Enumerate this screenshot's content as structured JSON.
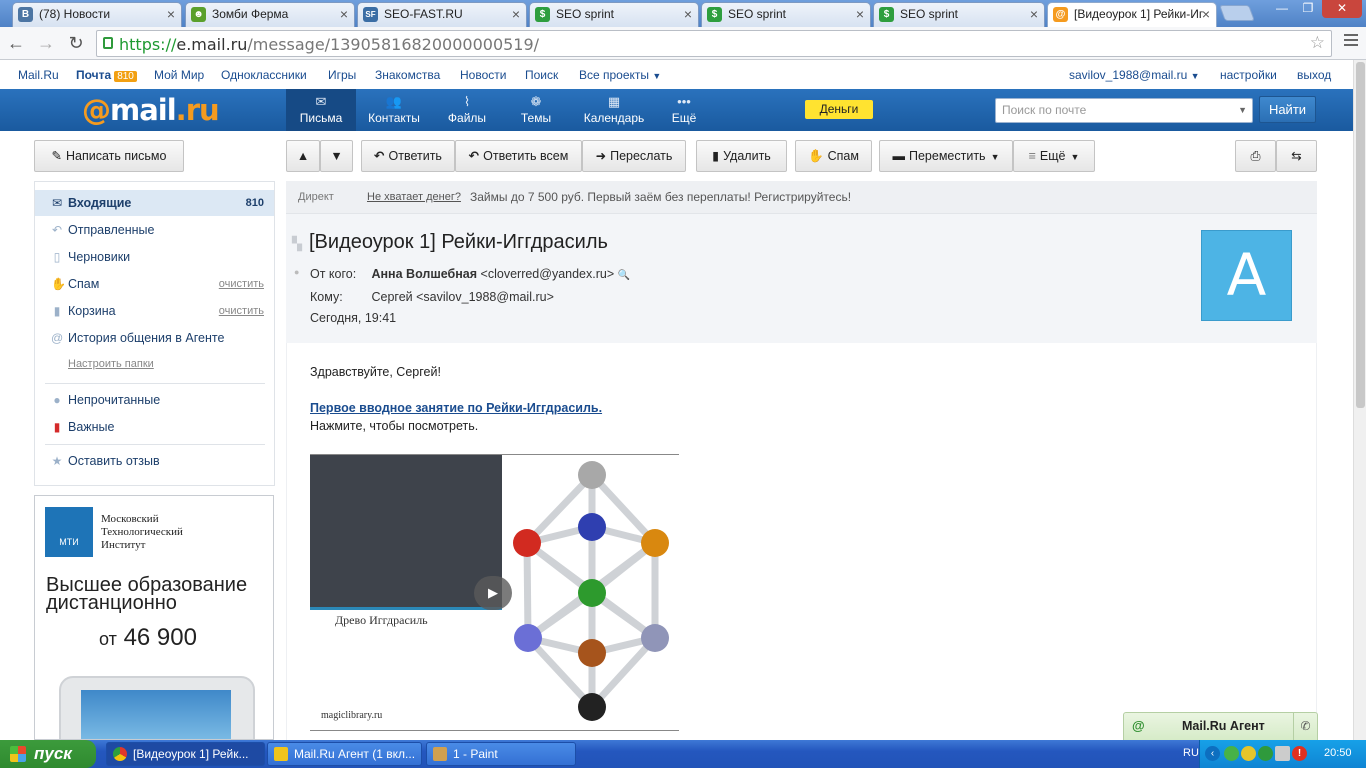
{
  "browser": {
    "tabs": [
      {
        "title": "(78) Новости",
        "icon": "vk-icon",
        "color": "#4c75a3",
        "glyph": "B"
      },
      {
        "title": "Зомби Ферма",
        "icon": "zombie-icon",
        "color": "#5aa02c",
        "glyph": "☻"
      },
      {
        "title": "SEO-FAST.RU",
        "icon": "seofast-icon",
        "color": "#3b6ea5",
        "glyph": "SF"
      },
      {
        "title": "SEO sprint",
        "icon": "seosprint-icon",
        "color": "#2e9e3e",
        "glyph": "$"
      },
      {
        "title": "SEO sprint",
        "icon": "seosprint-icon",
        "color": "#2e9e3e",
        "glyph": "$"
      },
      {
        "title": "SEO sprint",
        "icon": "seosprint-icon",
        "color": "#2e9e3e",
        "glyph": "$"
      },
      {
        "title": "[Видеоурок 1] Рейки-Иг",
        "icon": "mailru-icon",
        "color": "#f59b1f",
        "glyph": "@"
      }
    ],
    "url_scheme": "https://",
    "url_host": "e.mail.ru",
    "url_path": "/message/13905816820000000519/"
  },
  "portal": {
    "links": [
      "Mail.Ru",
      "Почта",
      "Мой Мир",
      "Одноклассники",
      "Игры",
      "Знакомства",
      "Новости",
      "Поиск",
      "Все проекты"
    ],
    "mail_count": "810",
    "user": "savilov_1988@mail.ru",
    "settings": "настройки",
    "logout": "выход"
  },
  "header": {
    "logo_at": "@",
    "logo_text": "mail",
    "logo_ru": ".ru",
    "nav": [
      {
        "label": "Письма",
        "icon": "envelope-icon"
      },
      {
        "label": "Контакты",
        "icon": "contacts-icon"
      },
      {
        "label": "Файлы",
        "icon": "paperclip-icon"
      },
      {
        "label": "Темы",
        "icon": "palette-icon"
      },
      {
        "label": "Календарь",
        "icon": "calendar-icon"
      },
      {
        "label": "Ещё",
        "icon": "dots-icon"
      }
    ],
    "money": "Деньги",
    "search_placeholder": "Поиск по почте",
    "search_button": "Найти"
  },
  "toolbar": {
    "compose": "Написать письмо",
    "reply": "Ответить",
    "reply_all": "Ответить всем",
    "forward": "Переслать",
    "delete": "Удалить",
    "spam": "Спам",
    "move": "Переместить",
    "more": "Ещё"
  },
  "sidebar": {
    "folders": [
      {
        "label": "Входящие",
        "right": "810",
        "icon": "inbox-icon"
      },
      {
        "label": "Отправленные",
        "right": "",
        "icon": "sent-icon"
      },
      {
        "label": "Черновики",
        "right": "",
        "icon": "draft-icon"
      },
      {
        "label": "Спам",
        "right": "очистить",
        "icon": "spam-icon"
      },
      {
        "label": "Корзина",
        "right": "очистить",
        "icon": "trash-icon"
      },
      {
        "label": "История общения в Агенте",
        "right": "",
        "icon": "agent-history-icon"
      }
    ],
    "configure": "Настроить папки",
    "unread": "Непрочитанные",
    "important": "Важные",
    "feedback": "Оставить отзыв"
  },
  "ad": {
    "logo_label": "МТИ",
    "institute": "Московский Технологический Институт",
    "headline": "Высшее образование дистанционно",
    "price_prefix": "от",
    "price": "46 900"
  },
  "message": {
    "direct_label": "Директ",
    "direct_link": "Не хватает денег?",
    "direct_text": "Займы до 7 500 руб. Первый заём без переплаты! Регистрируйтесь!",
    "subject": "[Видеоурок 1] Рейки-Иггдрасиль",
    "from_label": "От кого:",
    "from_name": "Анна Волшебная",
    "from_email": "<cloverred@yandex.ru>",
    "to_label": "Кому:",
    "to_value": "Сергей <savilov_1988@mail.ru>",
    "date": "Сегодня, 19:41",
    "avatar_letter": "А",
    "greeting": "Здравствуйте, Сергей!",
    "lesson_link": "Первое вводное занятие по Рейки-Иггдрасиль.",
    "click_text": "Нажмите, чтобы посмотреть.",
    "video_title": "Древо Иггдрасиль",
    "video_site": "magiclibrary.ru"
  },
  "agent": {
    "title": "Mail.Ru Агент"
  },
  "taskbar": {
    "start": "пуск",
    "tasks": [
      "[Видеоурок 1] Рейк...",
      "Mail.Ru Агент (1 вкл...",
      "1 - Paint"
    ],
    "lang": "RU",
    "time": "20:50"
  }
}
